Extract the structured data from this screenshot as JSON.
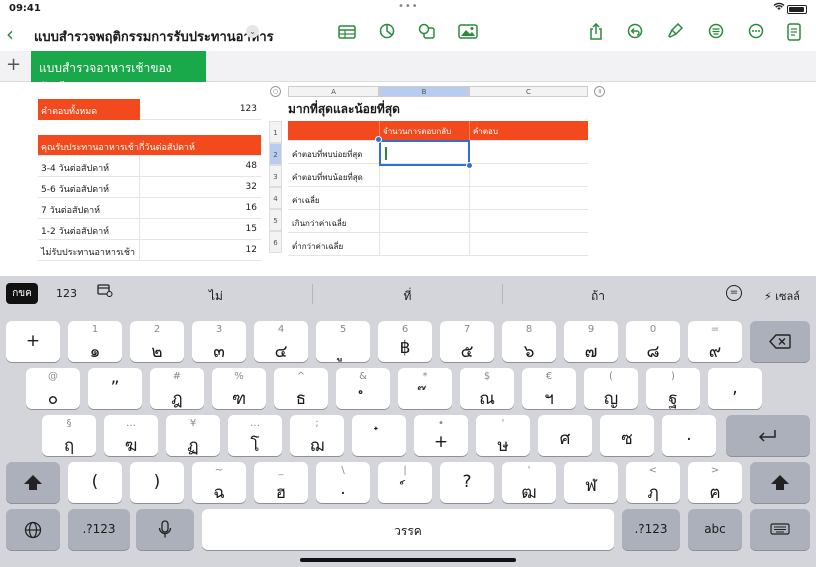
{
  "status": {
    "time": "09:41",
    "dots": "•••"
  },
  "toolbar": {
    "back": "‹",
    "title": "แบบสำรวจพฤติกรรมการรับประทานอาหาร",
    "title_chevron": "⌄",
    "icons": [
      "table-icon",
      "chart-icon",
      "shapes-icon",
      "media-icon",
      "share-icon",
      "undo-icon",
      "format-brush-icon",
      "format-icon",
      "more-icon",
      "document-icon"
    ]
  },
  "sheets": {
    "add": "+",
    "active": "แบบสำรวจอาหารเช้าของนักเรียน"
  },
  "left_table": {
    "total_label": "คำตอบทั้งหมด",
    "total_value": "123",
    "header": "คุณรับประทานอาหารเช้ากี่วันต่อสัปดาห์",
    "rows": [
      {
        "label": "3-4 วันต่อสัปดาห์",
        "value": "48"
      },
      {
        "label": "5-6 วันต่อสัปดาห์",
        "value": "32"
      },
      {
        "label": "7 วันต่อสัปดาห์",
        "value": "16"
      },
      {
        "label": "1-2 วันต่อสัปดาห์",
        "value": "15"
      },
      {
        "label": "ไม่รับประทานอาหารเช้า",
        "value": "12"
      }
    ]
  },
  "right_table": {
    "columns": [
      "A",
      "B",
      "C"
    ],
    "row_numbers": [
      "1",
      "2",
      "3",
      "4",
      "5",
      "6"
    ],
    "title": "มากที่สุดและน้อยที่สุด",
    "header": [
      "",
      "จำนวนการตอบกลับ",
      "คำตอบ"
    ],
    "rows": [
      "คำตอบที่พบบ่อยที่สุด",
      "คำตอบที่พบน้อยที่สุด",
      "ค่าเฉลี่ย",
      "เกินกว่าค่าเฉลี่ย",
      "ต่ำกว่าค่าเฉลี่ย"
    ],
    "corner": "○",
    "pause": "॥"
  },
  "keyboard": {
    "suggestions": {
      "lang": "กขค",
      "numeric": "123",
      "words": [
        "ไม่",
        "ที่",
        "ถ้า"
      ],
      "eq": "=",
      "cell": "⚡ เซลล์"
    },
    "row1": [
      {
        "alt": "",
        "main": "+"
      },
      {
        "alt": "1",
        "main": "๑"
      },
      {
        "alt": "2",
        "main": "๒"
      },
      {
        "alt": "3",
        "main": "๓"
      },
      {
        "alt": "4",
        "main": "๔"
      },
      {
        "alt": "5",
        "main": "ู"
      },
      {
        "alt": "6",
        "main": "฿"
      },
      {
        "alt": "7",
        "main": "๕"
      },
      {
        "alt": "8",
        "main": "๖"
      },
      {
        "alt": "9",
        "main": "๗"
      },
      {
        "alt": "0",
        "main": "๘"
      },
      {
        "alt": "=",
        "main": "๙"
      }
    ],
    "row2": [
      {
        "alt": "@",
        "main": "๐"
      },
      {
        "alt": "",
        "main": "”"
      },
      {
        "alt": "#",
        "main": "ฎ"
      },
      {
        "alt": "%",
        "main": "ฑ"
      },
      {
        "alt": "^",
        "main": "ธ"
      },
      {
        "alt": "&",
        "main": "ํ"
      },
      {
        "alt": "*",
        "main": "๊"
      },
      {
        "alt": "$",
        "main": "ณ"
      },
      {
        "alt": "€",
        "main": "ฯ"
      },
      {
        "alt": "(",
        "main": "ญ"
      },
      {
        "alt": ")",
        "main": "ฐ"
      },
      {
        "alt": "",
        "main": ","
      }
    ],
    "row3": [
      {
        "alt": "§",
        "main": "ฤ"
      },
      {
        "alt": "…",
        "main": "ฆ"
      },
      {
        "alt": "¥",
        "main": "ฏ"
      },
      {
        "alt": "…",
        "main": "โ"
      },
      {
        "alt": ";",
        "main": "ฌ"
      },
      {
        "alt": "",
        "main": "๋"
      },
      {
        "alt": "•",
        "main": "+"
      },
      {
        "alt": "'",
        "main": "ษ"
      },
      {
        "alt": "",
        "main": "ศ"
      },
      {
        "alt": "",
        "main": "ซ"
      },
      {
        "alt": "",
        "main": "."
      }
    ],
    "row4": [
      {
        "alt": "",
        "main": "("
      },
      {
        "alt": "",
        "main": ")"
      },
      {
        "alt": "~",
        "main": "ฉ"
      },
      {
        "alt": "_",
        "main": "ฮ"
      },
      {
        "alt": "\\",
        "main": "."
      },
      {
        "alt": "|",
        "main": "์"
      },
      {
        "alt": "",
        "main": "?"
      },
      {
        "alt": "'",
        "main": "ฒ"
      },
      {
        "alt": "",
        "main": "ฬ"
      },
      {
        "alt": "<",
        "main": "ฦ"
      },
      {
        "alt": ">",
        "main": "ฅ"
      }
    ],
    "bottom": {
      "n123": ".?123",
      "space": "วรรค",
      "abc": "abc"
    }
  }
}
